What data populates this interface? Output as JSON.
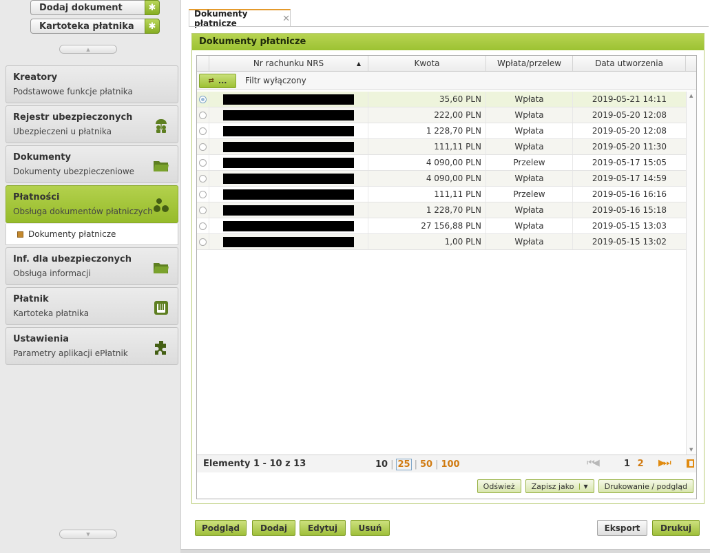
{
  "sidebar": {
    "quick_actions": [
      {
        "label": "Dodaj dokument",
        "icon": "gear-plus-icon"
      },
      {
        "label": "Kartoteka płatnika",
        "icon": "gear-plus-icon"
      }
    ],
    "menu": [
      {
        "title": "Kreatory",
        "subtitle": "Podstawowe funkcje płatnika",
        "icon": ""
      },
      {
        "title": "Rejestr ubezpieczonych",
        "subtitle": "Ubezpieczeni u płatnika",
        "icon": "insured-people-icon"
      },
      {
        "title": "Dokumenty",
        "subtitle": "Dokumenty ubezpieczeniowe",
        "icon": "folder-icon"
      },
      {
        "title": "Płatności",
        "subtitle": "Obsługa dokumentów płatniczych",
        "icon": "coins-icon"
      },
      {
        "title": "Inf. dla ubezpieczonych",
        "subtitle": "Obsługa informacji",
        "icon": "folder-icon"
      },
      {
        "title": "Płatnik",
        "subtitle": "Kartoteka płatnika",
        "icon": "binder-icon"
      },
      {
        "title": "Ustawienia",
        "subtitle": "Parametry aplikacji ePłatnik",
        "icon": "puzzle-icon"
      }
    ],
    "active_index": 3,
    "submenu_item": "Dokumenty płatnicze"
  },
  "main": {
    "tab_label": "Dokumenty płatnicze",
    "panel_title": "Dokumenty płatnicze",
    "columns": [
      "Nr rachunku NRS",
      "Kwota",
      "Wpłata/przelew",
      "Data utworzenia"
    ],
    "filter_button_label": "...",
    "filter_status": "Filtr wyłączony",
    "rows": [
      {
        "kwota": "35,60 PLN",
        "typ": "Wpłata",
        "data": "2019-05-21 14:11",
        "selected": true
      },
      {
        "kwota": "222,00 PLN",
        "typ": "Wpłata",
        "data": "2019-05-20 12:08"
      },
      {
        "kwota": "1 228,70 PLN",
        "typ": "Wpłata",
        "data": "2019-05-20 12:08"
      },
      {
        "kwota": "111,11 PLN",
        "typ": "Wpłata",
        "data": "2019-05-20 11:30"
      },
      {
        "kwota": "4 090,00 PLN",
        "typ": "Przelew",
        "data": "2019-05-17 15:05"
      },
      {
        "kwota": "4 090,00 PLN",
        "typ": "Wpłata",
        "data": "2019-05-17 14:59"
      },
      {
        "kwota": "111,11 PLN",
        "typ": "Przelew",
        "data": "2019-05-16 16:16"
      },
      {
        "kwota": "1 228,70 PLN",
        "typ": "Wpłata",
        "data": "2019-05-16 15:18"
      },
      {
        "kwota": "27 156,88 PLN",
        "typ": "Wpłata",
        "data": "2019-05-15 13:03"
      },
      {
        "kwota": "1,00 PLN",
        "typ": "Wpłata",
        "data": "2019-05-15 13:02"
      }
    ],
    "pager": {
      "elements_text": "Elementy 1 - 10 z 13",
      "page_sizes": [
        "10",
        "25",
        "50",
        "100"
      ],
      "current_page_size": "25",
      "pages": [
        "1",
        "2"
      ],
      "current_page": "1"
    },
    "grid_actions": {
      "refresh": "Odśwież",
      "save_as": "Zapisz jako",
      "print_preview": "Drukowanie / podgląd"
    },
    "bottom_actions": {
      "preview": "Podgląd",
      "add": "Dodaj",
      "edit": "Edytuj",
      "delete": "Usuń",
      "export": "Eksport",
      "print": "Drukuj"
    }
  }
}
